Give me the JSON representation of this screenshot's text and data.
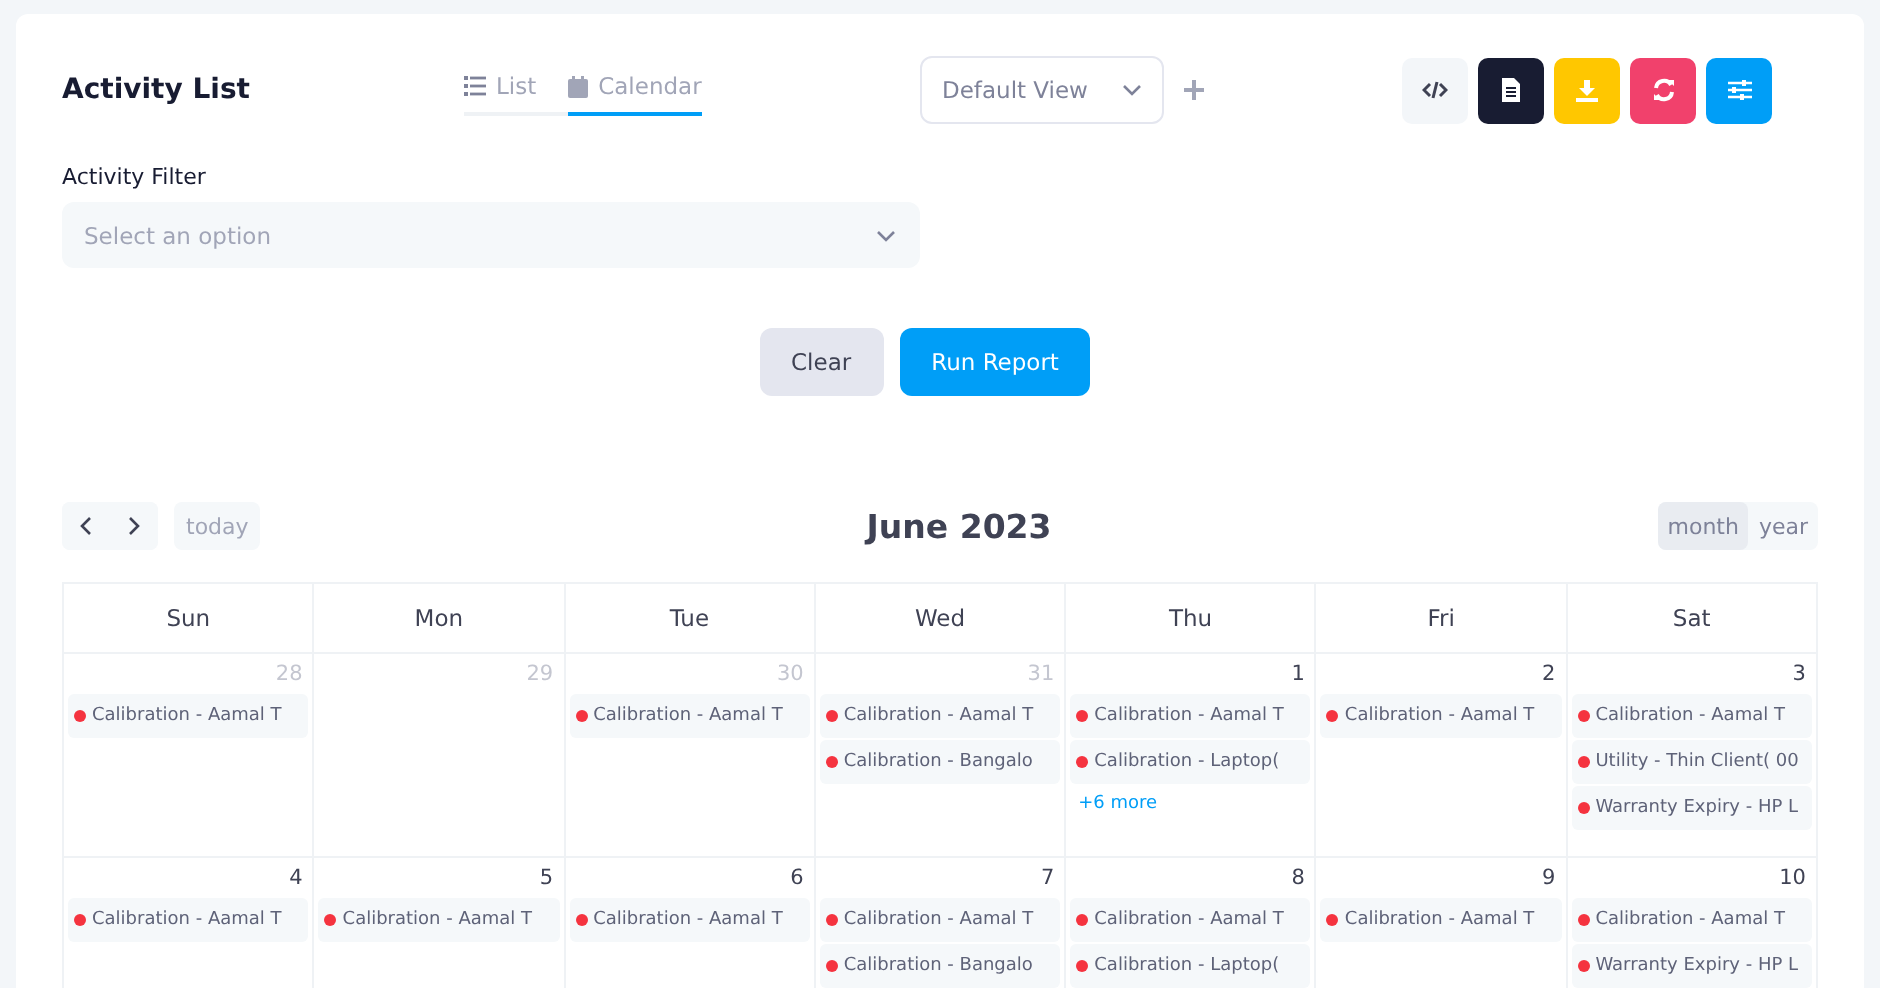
{
  "header": {
    "title": "Activity List",
    "tabs": [
      {
        "label": "List",
        "selected": false
      },
      {
        "label": "Calendar",
        "selected": true
      }
    ],
    "view_select": {
      "value": "Default View"
    },
    "toolbar": [
      {
        "kind": "code"
      },
      {
        "kind": "document"
      },
      {
        "kind": "download"
      },
      {
        "kind": "refresh"
      },
      {
        "kind": "sliders"
      }
    ]
  },
  "filter": {
    "label": "Activity Filter",
    "placeholder": "Select an option"
  },
  "actions": [
    {
      "label": "Clear",
      "kind": "secondary"
    },
    {
      "label": "Run Report",
      "kind": "primary"
    }
  ],
  "calendar": {
    "title": "June 2023",
    "today_button": "today",
    "views": [
      {
        "label": "month",
        "selected": true
      },
      {
        "label": "year",
        "selected": false
      }
    ],
    "weekdays": [
      "Sun",
      "Mon",
      "Tue",
      "Wed",
      "Thu",
      "Fri",
      "Sat"
    ],
    "weeks": [
      [
        {
          "day": "28",
          "other_month": true,
          "events": [
            {
              "title": "Calibration - Aamal T",
              "color": "#f5333f"
            }
          ]
        },
        {
          "day": "29",
          "other_month": true
        },
        {
          "day": "30",
          "other_month": true,
          "events": [
            {
              "title": "Calibration - Aamal T",
              "color": "#f5333f"
            }
          ]
        },
        {
          "day": "31",
          "other_month": true,
          "events": [
            {
              "title": "Calibration - Aamal T",
              "color": "#f5333f"
            },
            {
              "title": "Calibration - Bangalo",
              "color": "#f5333f"
            }
          ]
        },
        {
          "day": "1",
          "other_month": false,
          "events": [
            {
              "title": "Calibration - Aamal T",
              "color": "#f5333f"
            },
            {
              "title": "Calibration - Laptop(",
              "color": "#f5333f"
            }
          ],
          "more": "+6 more"
        },
        {
          "day": "2",
          "other_month": false,
          "events": [
            {
              "title": "Calibration - Aamal T",
              "color": "#f5333f"
            }
          ]
        },
        {
          "day": "3",
          "other_month": false,
          "events": [
            {
              "title": "Calibration - Aamal T",
              "color": "#f5333f"
            },
            {
              "title": "Utility - Thin Client( 00",
              "color": "#f5333f"
            },
            {
              "title": "Warranty Expiry - HP L",
              "color": "#f5333f"
            }
          ]
        }
      ],
      [
        {
          "day": "4",
          "other_month": false,
          "events": [
            {
              "title": "Calibration - Aamal T",
              "color": "#f5333f"
            }
          ]
        },
        {
          "day": "5",
          "other_month": false,
          "events": [
            {
              "title": "Calibration - Aamal T",
              "color": "#f5333f"
            }
          ]
        },
        {
          "day": "6",
          "other_month": false,
          "events": [
            {
              "title": "Calibration - Aamal T",
              "color": "#f5333f"
            }
          ]
        },
        {
          "day": "7",
          "other_month": false,
          "events": [
            {
              "title": "Calibration - Aamal T",
              "color": "#f5333f"
            },
            {
              "title": "Calibration - Bangalo",
              "color": "#f5333f"
            }
          ]
        },
        {
          "day": "8",
          "other_month": false,
          "events": [
            {
              "title": "Calibration - Aamal T",
              "color": "#f5333f"
            },
            {
              "title": "Calibration - Laptop(",
              "color": "#f5333f"
            }
          ]
        },
        {
          "day": "9",
          "other_month": false,
          "events": [
            {
              "title": "Calibration - Aamal T",
              "color": "#f5333f"
            }
          ]
        },
        {
          "day": "10",
          "other_month": false,
          "events": [
            {
              "title": "Calibration - Aamal T",
              "color": "#f5333f"
            },
            {
              "title": "Warranty Expiry - HP L",
              "color": "#f5333f"
            }
          ]
        }
      ]
    ]
  }
}
